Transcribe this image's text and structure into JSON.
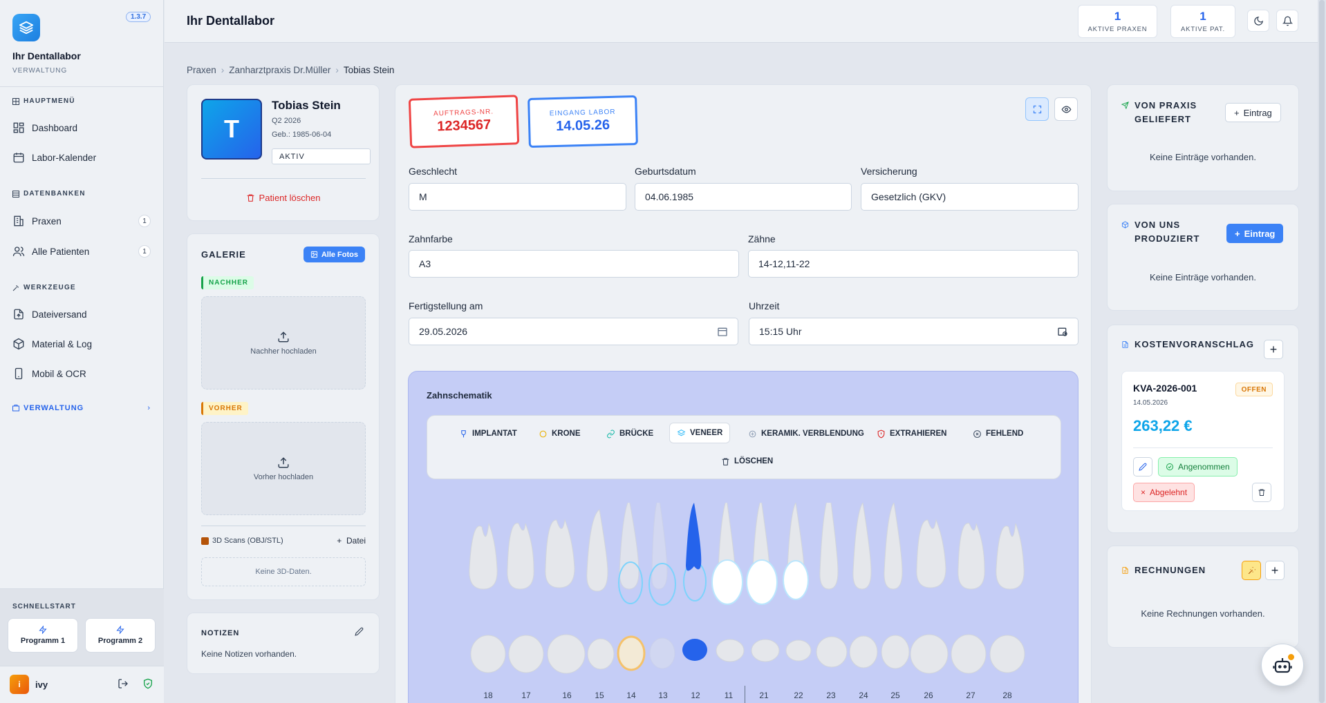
{
  "app": {
    "name": "Ihr Dentallabor",
    "subtitle": "VERWALTUNG",
    "version": "1.3.7",
    "accent": "#2563eb"
  },
  "sidebar": {
    "sections": [
      {
        "title": "HAUPTMENÜ"
      },
      {
        "title": "DATENBANKEN"
      },
      {
        "title": "WERKZEUGE"
      }
    ],
    "items": [
      {
        "label": "Dashboard",
        "icon": "dashboard-icon"
      },
      {
        "label": "Labor-Kalender",
        "icon": "calendar-icon"
      },
      {
        "label": "Praxen",
        "icon": "building-icon",
        "count": "1"
      },
      {
        "label": "Alle Patienten",
        "icon": "users-icon",
        "count": "1"
      },
      {
        "label": "Dateiversand",
        "icon": "file-upload-icon"
      },
      {
        "label": "Material & Log",
        "icon": "package-icon"
      },
      {
        "label": "Mobil & OCR",
        "icon": "smartphone-icon"
      }
    ],
    "admin_label": "VERWALTUNG",
    "quickstart": {
      "title": "SCHNELLSTART",
      "buttons": [
        "Programm 1",
        "Programm 2"
      ]
    },
    "user": {
      "initial": "i",
      "name": "ivy"
    }
  },
  "header": {
    "title": "Ihr Dentallabor",
    "stats": [
      {
        "value": "1",
        "label": "AKTIVE PRAXEN"
      },
      {
        "value": "1",
        "label": "AKTIVE PAT."
      }
    ]
  },
  "breadcrumb": [
    "Praxen",
    "Zanharztpraxis Dr.Müller",
    "Tobias Stein"
  ],
  "patient": {
    "initial": "T",
    "name": "Tobias Stein",
    "quarter": "Q2 2026",
    "birth": "Geb.: 1985-06-04",
    "status": "AKTIV",
    "delete_label": "Patient löschen"
  },
  "gallery": {
    "title": "GALERIE",
    "all_photos": "Alle Fotos",
    "after_tag": "NACHHER",
    "after_upload": "Nachher hochladen",
    "before_tag": "VORHER",
    "before_upload": "Vorher hochladen",
    "scans_label": "3D Scans (OBJ/STL)",
    "scans_add": "Datei",
    "scans_empty": "Keine 3D-Daten."
  },
  "notes": {
    "title": "NOTIZEN",
    "empty": "Keine Notizen vorhanden."
  },
  "order": {
    "stamp_order_label": "AUFTRAGS-NR.",
    "stamp_order_value": "1234567",
    "stamp_lab_label": "EINGANG LABOR",
    "stamp_lab_value": "14.05.26",
    "fields": {
      "geschlecht": {
        "label": "Geschlecht",
        "value": "M"
      },
      "geburtsdatum": {
        "label": "Geburtsdatum",
        "value": "04.06.1985"
      },
      "versicherung": {
        "label": "Versicherung",
        "value": "Gesetzlich (GKV)"
      },
      "zahnfarbe": {
        "label": "Zahnfarbe",
        "value": "A3"
      },
      "zaehne": {
        "label": "Zähne",
        "value": "14-12,11-22"
      },
      "fertigstellung": {
        "label": "Fertigstellung am",
        "value": "29.05.2026"
      },
      "uhrzeit": {
        "label": "Uhrzeit",
        "value": "15:15 Uhr"
      }
    }
  },
  "schematic": {
    "title": "Zahnschematik",
    "tools": [
      {
        "label": "IMPLANTAT",
        "icon": "implant-icon",
        "color": "#2563eb"
      },
      {
        "label": "KRONE",
        "icon": "crown-icon",
        "color": "#eab308"
      },
      {
        "label": "BRÜCKE",
        "icon": "link-icon",
        "color": "#14b8a6"
      },
      {
        "label": "VENEER",
        "icon": "veneer-icon",
        "color": "#38bdf8",
        "active": true
      },
      {
        "label": "KERAMIK. VERBLENDUNG",
        "icon": "ceramic-icon",
        "color": "#94a3b8"
      },
      {
        "label": "EXTRAHIEREN",
        "icon": "shield-icon",
        "color": "#dc2626"
      },
      {
        "label": "FEHLEND",
        "icon": "x-circle-icon",
        "color": "#475569"
      },
      {
        "label": "LÖSCHEN",
        "icon": "trash-icon",
        "color": "#334155"
      }
    ],
    "tooth_numbers": [
      "18",
      "17",
      "16",
      "15",
      "14",
      "13",
      "12",
      "11",
      "21",
      "22",
      "23",
      "24",
      "25",
      "26",
      "27",
      "28"
    ]
  },
  "right": {
    "from_practice": {
      "title": [
        "VON PRAXIS",
        "GELIEFERT"
      ],
      "button": "Eintrag",
      "empty": "Keine Einträge vorhanden."
    },
    "produced": {
      "title": [
        "VON UNS",
        "PRODUZIERT"
      ],
      "button": "Eintrag",
      "empty": "Keine Einträge vorhanden."
    },
    "estimate": {
      "title": "KOSTENVORANSCHLAG",
      "id": "KVA-2026-001",
      "status": "OFFEN",
      "date": "14.05.2026",
      "amount": "263,22 €",
      "accept": "Angenommen",
      "reject": "Abgelehnt"
    },
    "invoices": {
      "title": "RECHNUNGEN",
      "empty": "Keine Rechnungen vorhanden."
    }
  }
}
